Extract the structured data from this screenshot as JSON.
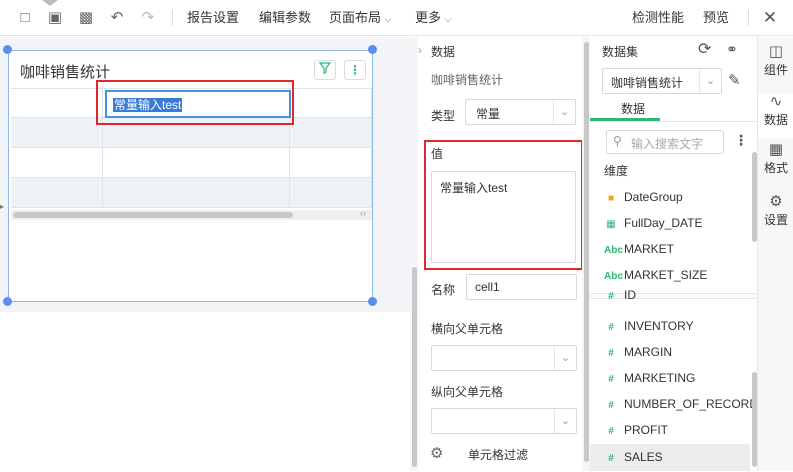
{
  "toolbar": {
    "menus": [
      "报告设置",
      "编辑参数",
      "页面布局",
      "更多"
    ],
    "right": [
      "检测性能",
      "预览"
    ]
  },
  "widget": {
    "title": "咖啡销售统计",
    "cell_value": "常量输入test"
  },
  "panel": {
    "header": "数据",
    "subtitle": "咖啡销售统计",
    "type_label": "类型",
    "type_value": "常量",
    "value_label": "值",
    "value_text": "常量输入test",
    "name_label": "名称",
    "name_value": "cell1",
    "h_parent_label": "横向父单元格",
    "v_parent_label": "纵向父单元格",
    "filter_label": "单元格过滤"
  },
  "dataset": {
    "header": "数据集",
    "selected": "咖啡销售统计",
    "tab": "数据",
    "search_placeholder": "输入搜索文字",
    "dimension_label": "维度",
    "dimensions": [
      {
        "name": "DateGroup",
        "icon": "folder-icon"
      },
      {
        "name": "FullDay_DATE",
        "icon": "calendar-icon"
      },
      {
        "name": "MARKET",
        "icon": "abc-icon"
      },
      {
        "name": "MARKET_SIZE",
        "icon": "abc-icon"
      }
    ],
    "measures": [
      "ID",
      "INVENTORY",
      "MARGIN",
      "MARKETING",
      "NUMBER_OF_RECORDS",
      "PROFIT",
      "SALES"
    ],
    "accent": "#2eb872"
  },
  "sidebar": [
    "组件",
    "数据",
    "格式",
    "设置"
  ]
}
